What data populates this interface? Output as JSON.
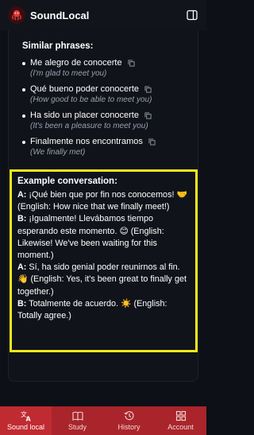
{
  "header": {
    "title": "SoundLocal"
  },
  "similar": {
    "title": "Similar phrases:",
    "items": [
      {
        "es": "Me alegro de conocerte",
        "en": "(I'm glad to meet you)"
      },
      {
        "es": "Qué bueno poder conocerte",
        "en": "(How good to be able to meet you)"
      },
      {
        "es": "Ha sido un placer conocerte",
        "en": "(It's been a pleasure to meet you)"
      },
      {
        "es": "Finalmente nos encontramos",
        "en": "(We finally met)"
      }
    ]
  },
  "example": {
    "title": "Example conversation:",
    "lines": [
      {
        "speaker": "A:",
        "text": " ¡Qué bien que por fin nos conocemos! 🤝 (English: How nice that we finally meet!)"
      },
      {
        "speaker": "B:",
        "text": " ¡Igualmente! Llevábamos tiempo esperando este momento. 😊 (English: Likewise! We've been waiting for this moment.)"
      },
      {
        "speaker": "A:",
        "text": " Sí, ha sido genial poder reunirnos al fin. 👋 (English: Yes, it's been great to finally get together.)"
      },
      {
        "speaker": "B:",
        "text": " Totalmente de acuerdo. ☀️ (English: Totally agree.)"
      }
    ]
  },
  "nav": [
    {
      "label": "Sound local",
      "icon": "translate-icon"
    },
    {
      "label": "Study",
      "icon": "book-icon"
    },
    {
      "label": "History",
      "icon": "history-icon"
    },
    {
      "label": "Account",
      "icon": "grid-icon"
    }
  ],
  "colors": {
    "accent": "#a9252b",
    "highlight": "#f2e81a",
    "background": "#0d1016"
  }
}
